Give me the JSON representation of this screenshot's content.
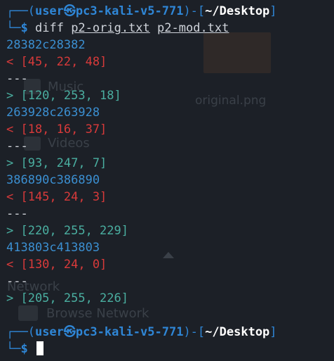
{
  "prompt": {
    "user": "user",
    "at_symbol": "㉿",
    "host": "pc3-kali-v5-771",
    "cwd": "~/Desktop",
    "dollar": "$"
  },
  "command": {
    "name": "diff",
    "arg1": "p2-orig.txt",
    "arg2": "p2-mod.txt"
  },
  "diff_output": [
    {
      "type": "hunk",
      "text": "28382c28382"
    },
    {
      "type": "removed",
      "text": "< [45, 22, 48]"
    },
    {
      "type": "sep",
      "text": "---"
    },
    {
      "type": "added",
      "text": "> [120, 253, 18]"
    },
    {
      "type": "hunk",
      "text": "263928c263928"
    },
    {
      "type": "removed",
      "text": "< [18, 16, 37]"
    },
    {
      "type": "sep",
      "text": "---"
    },
    {
      "type": "added",
      "text": "> [93, 247, 7]"
    },
    {
      "type": "hunk",
      "text": "386890c386890"
    },
    {
      "type": "removed",
      "text": "< [145, 24, 3]"
    },
    {
      "type": "sep",
      "text": "---"
    },
    {
      "type": "added",
      "text": "> [220, 255, 229]"
    },
    {
      "type": "hunk",
      "text": "413803c413803"
    },
    {
      "type": "removed",
      "text": "< [130, 24, 0]"
    },
    {
      "type": "sep",
      "text": "---"
    },
    {
      "type": "added",
      "text": "> [205, 255, 226]"
    }
  ],
  "background_desktop": {
    "thumbnail_label": "original.png",
    "items": [
      "Music",
      "Videos",
      "Network",
      "Browse Network"
    ]
  },
  "colors": {
    "background": "#1c2027",
    "prompt_blue": "#2f86d6",
    "hunk_blue": "#3b8fd1",
    "removed_red": "#d83a3a",
    "added_teal": "#4aaea0"
  }
}
